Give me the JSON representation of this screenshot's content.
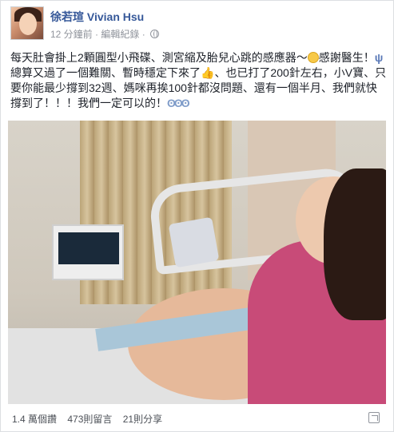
{
  "post": {
    "author": "徐若瑄 Vivian Hsu",
    "time": "12 分鐘前",
    "separator": "·",
    "edit_history": "編輯紀錄",
    "separator2": "·",
    "text_part1": "每天肚會掛上2顆圓型小飛碟、測宮縮及胎兒心跳的感應器～",
    "text_part2": "感謝醫生！",
    "text_part3": "總算又過了一個難關、暫時穩定下來了",
    "text_part4": "、也已打了200針左右，小V寶、只要你能最少撐到32週、媽咪再挨100針都沒問題、還有一個半月、我們就快撐到了！！！我們一定可以的！"
  },
  "icons": {
    "smile": "smile-emoji-icon",
    "fork": "fork-knife-icon",
    "thumb": "thumbs-up-icon",
    "hands": "hands-icon",
    "globe": "globe-icon",
    "share": "share-icon"
  },
  "footer": {
    "likes": "1.4 萬個讚",
    "comments": "473則留言",
    "shares": "21則分享"
  },
  "colors": {
    "author_link": "#365899",
    "meta": "#90949c",
    "text": "#1d2129"
  }
}
